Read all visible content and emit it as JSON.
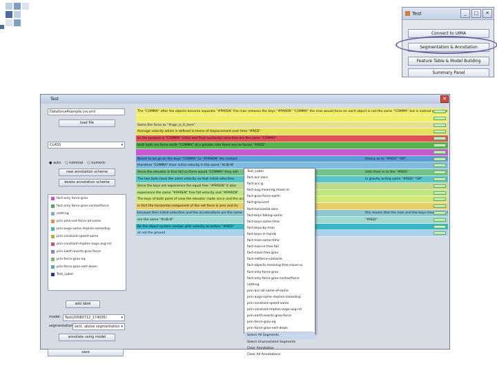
{
  "slide": {
    "deco_colors": [
      "#bcd0e6",
      "#7f9fc4",
      "#4a6f9c",
      "#dbe5f0"
    ]
  },
  "mini_window": {
    "title": "Test",
    "buttons": [
      "Connect to UIMA",
      "Segmentation & Annotation",
      "Feature Table & Model Building",
      "Summary Panel"
    ],
    "highlight_color": "#6a5fa8"
  },
  "main_window": {
    "title": "Test",
    "close_glyph": "✕",
    "left": {
      "file_field": "Dataforce4sample.csv.xml",
      "load_button": "load file",
      "class_select": "CLASS",
      "radio_options": [
        "auto",
        "nominal",
        "numeric"
      ],
      "new_scheme_button": "new annotation scheme",
      "delete_scheme_button": "delete annotation scheme",
      "segments": [
        {
          "label": "fact-only force-grav",
          "color": "#c64fc9"
        },
        {
          "label": "fact-only force-grav-contactforce",
          "color": "#52a852"
        },
        {
          "label": "nothing",
          "color": "#7fa7d9"
        },
        {
          "label": "prin-zero-net-force-all-same",
          "color": "#e3904b"
        },
        {
          "label": "prin-avgv-same-implies-samedisp",
          "color": "#43b7b7"
        },
        {
          "label": "prin-constant-speed-same",
          "color": "#b8b02f"
        },
        {
          "label": "prin-constant-implies-avgv-avg-int",
          "color": "#d34a84"
        },
        {
          "label": "prin-earth-exerts-grav-force",
          "color": "#8d7bd4"
        },
        {
          "label": "prin-force-grav-eq",
          "color": "#6fbf5f"
        },
        {
          "label": "prin-force-grav-vert-down",
          "color": "#5fa2c7"
        },
        {
          "label": "Test_Label",
          "color": "#2b3a8f"
        }
      ],
      "add_label_button": "add label",
      "model_label": "model:",
      "model_value": "Test(20080712_174005)",
      "segmentation_label": "segmentation:",
      "segmentation_value": "sent. above segmentation",
      "annotate_button": "annotate using model",
      "save_button": "save"
    },
    "rows": [
      {
        "text": "The \"COMMA\" after the objects become separate \"#PAREN\" the man releases the keys \"#PAREN\" \"COMMA\" the man would force on each object is not the same \"COMMA\" but is instead proportional to force as \"#LIB-N\"",
        "color": "#f3ee67"
      },
      {
        "text": "",
        "color": "#f3ee67"
      },
      {
        "text": "Same the force as \"#vgn_is_it_here\"",
        "color": "#e4e08c"
      },
      {
        "text": "Average velocity which is defined in terms of displacement over time \"#RED\"",
        "color": "#e6e05a"
      },
      {
        "text": "so the purpose is \"COMMA\" initial and final horizontal velocities are the same \"COMMA\"",
        "color": "#de5454"
      },
      {
        "text": "both balls are force earth \"COMMA\" at a greater rate there are no forces \"#RED\"",
        "color": "#55b34c"
      },
      {
        "text": "",
        "color": "#c45ccf"
      },
      {
        "text": "Needs to be go on the keys \"COMMA\" to \"#PAREN\" the contact",
        "color": "#5a9bd8"
      },
      {
        "text": "therefore \"COMMA\" their initial velocity is the same \"#LIB-N\"",
        "color": "#7fbde0"
      },
      {
        "text": "Since the elevator is free fall so there would \"COMMA\" they will",
        "color": "#72c28a"
      },
      {
        "text": "The two balls have the same velocity so that initial velocities",
        "color": "#59c6c9"
      },
      {
        "text": "Since the keys are experience the equal free \"#PAREN\" it also",
        "color": "#bfd98a"
      },
      {
        "text": "experience the same \"#PAREN\" free fall velocity and \"#PAREN\"",
        "color": "#bfe67a"
      },
      {
        "text": "The keys of both point of view the elevator made since and the acceleration",
        "color": "#d3e879"
      },
      {
        "text": "in fact the horizontal component of the net force is zero and its",
        "color": "#e6cf66"
      },
      {
        "text": "because their initial velocities and the accelerations are the same",
        "color": "#8ec7d2"
      },
      {
        "text": "are the same \"#LIB-N\"",
        "color": "#9fd9cf"
      },
      {
        "text": "Be the object system contain with velocity as before \"#RED\"",
        "color": "#39b7c6"
      },
      {
        "text": "at not the ground",
        "color": "#a9d3ec"
      }
    ],
    "row_tails": {
      "7": "theory as to \"#RED\" \"OR\"",
      "9": "Until their in to the \"#RED\"",
      "10": "in gravity acting same \"#RED\" \"OR\"",
      "15": "this means that the man and the keys move at the same distance ... acceleration is at",
      "16": "\"#RED\""
    },
    "context_menu": {
      "items": [
        "Test_Label",
        "fact-acc-zero",
        "fact-acc-g",
        "fact-avg.meaning.mean.m",
        "fact-grav-force-earth",
        "fact-grav-vert",
        "fact-horizontal-zero",
        "fact-keys-falling-same",
        "fact-keys-same-time",
        "fact-keys-by-man",
        "fact-keys-in-hands",
        "fact-man-same-time",
        "fact-man-in-free-fall",
        "fact-mass-free-grav",
        "fact-netforce-contacts",
        "fact-objects-meaning-free-move-vs",
        "fact-only-force-grav",
        "fact-only-force-grav-contactforce",
        "nothing",
        "prin-acc-all-same-of-same",
        "prin-avgv-same-implies-samedisp",
        "prin-constant-speed-same",
        "prin-constant-implies-avgv-avg-int",
        "prin-earth-exerts-grav-force",
        "prin-force-grav-eq",
        "prin-force-grav-vert-down"
      ],
      "actions": [
        "Select All Segments",
        "Select Unannotated Segments",
        "Clear Annotation",
        "Clear All Annotations"
      ]
    }
  }
}
